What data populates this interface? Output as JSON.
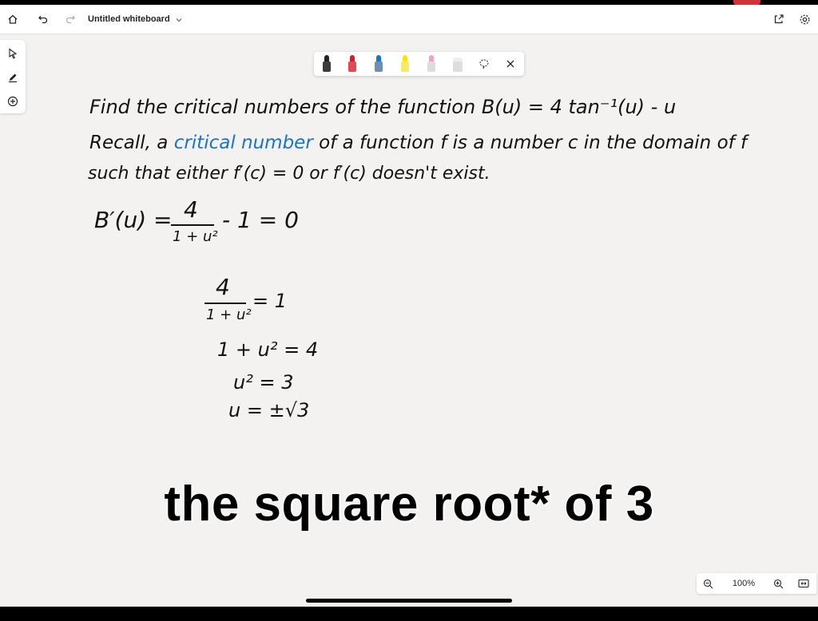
{
  "app": {
    "title": "Untitled whiteboard",
    "zoom": "100%"
  },
  "icons": {
    "top_left": [
      "home-icon",
      "undo-icon",
      "redo-icon"
    ],
    "title_dropdown": "chevron-down-icon",
    "top_right": [
      "share-icon",
      "settings-icon"
    ],
    "left_rail": [
      "select-arrow-icon",
      "pen-icon",
      "add-icon"
    ],
    "ink_toolbar": [
      "pen-black",
      "pen-red",
      "pen-blue",
      "highlighter-yellow",
      "highlighter-pink",
      "eraser",
      "lasso-icon",
      "close-icon"
    ],
    "zoom": [
      "zoom-out-icon",
      "zoom-in-icon",
      "fit-to-screen-icon"
    ]
  },
  "pen_colors": {
    "black": "#222222",
    "red": "#d41d2a",
    "blue": "#1a73c8",
    "yellow": "#ffe600",
    "pink": "#f2a0c4",
    "eraser": "#dddddd"
  },
  "whiteboard": {
    "line1": "Find the critical numbers of the function B(u) = 4 tan⁻¹(u) - u",
    "line2_pre": "Recall, a ",
    "line2_highlight": "critical number",
    "line2_post": " of a function f is a number c in the domain of f",
    "line3": "such that either f′(c) = 0  or  f′(c) doesn't exist.",
    "eq1_left": "B′(u) =",
    "eq1_num": "4",
    "eq1_den": "1 + u²",
    "eq1_right": "- 1 = 0",
    "eq2_num": "4",
    "eq2_den": "1 + u²",
    "eq2_right": "= 1",
    "eq3": "1 + u² = 4",
    "eq4": "u² = 3",
    "eq5": "u = ±√3"
  },
  "caption": "the square root* of 3",
  "accent_color": "#1a73c8"
}
